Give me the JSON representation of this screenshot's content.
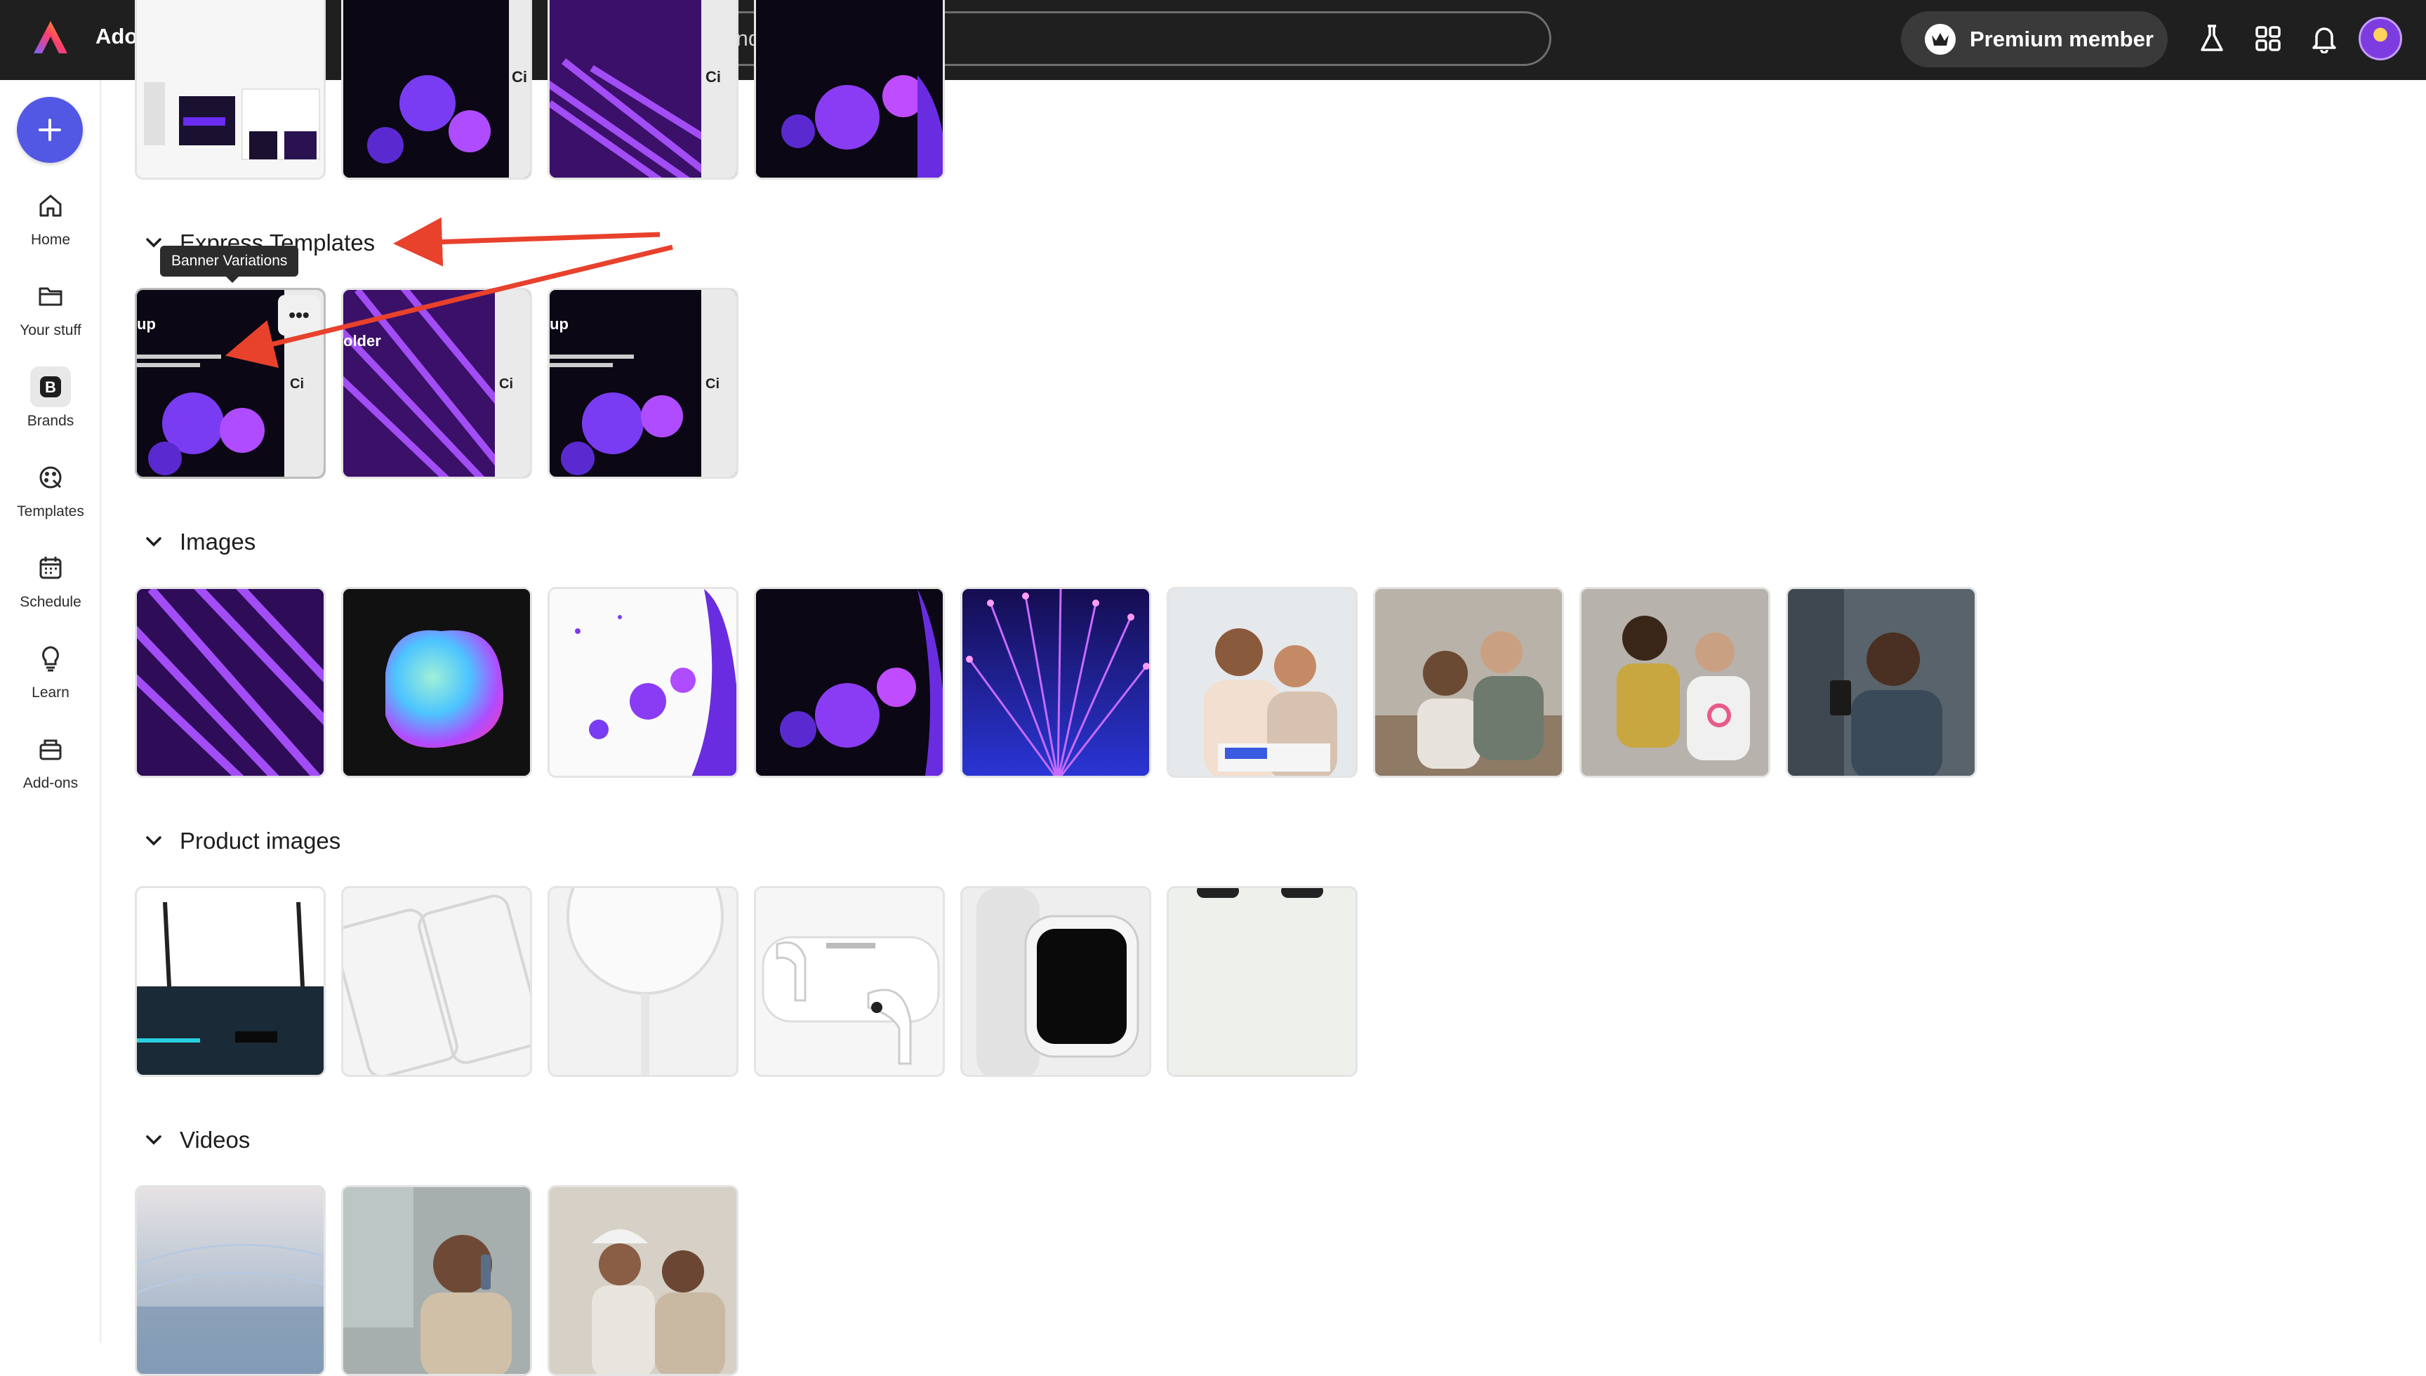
{
  "app": {
    "title": "Adobe Express"
  },
  "search": {
    "placeholder": "Search brands"
  },
  "header": {
    "premium_label": "Premium member"
  },
  "colors": {
    "topbar": "#1f1f1f",
    "accent": "#5258e4",
    "annotation": "#e8412c"
  },
  "rail": {
    "items": [
      {
        "label": "Home",
        "icon": "home-icon"
      },
      {
        "label": "Your stuff",
        "icon": "folder-icon"
      },
      {
        "label": "Brands",
        "icon": "brand-icon"
      },
      {
        "label": "Templates",
        "icon": "templates-icon"
      },
      {
        "label": "Schedule",
        "icon": "calendar-icon"
      },
      {
        "label": "Learn",
        "icon": "lightbulb-icon"
      },
      {
        "label": "Add-ons",
        "icon": "addons-icon"
      }
    ]
  },
  "sections": {
    "express_templates": {
      "title": "Express Templates",
      "tooltip": "Banner Variations"
    },
    "images": {
      "title": "Images"
    },
    "product_images": {
      "title": "Product images"
    },
    "videos": {
      "title": "Videos"
    }
  }
}
